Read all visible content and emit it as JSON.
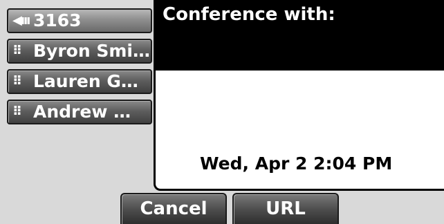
{
  "line_keys": [
    {
      "glyph": "◀ııı",
      "label": "3163",
      "active": true
    },
    {
      "glyph": "⠿",
      "label": "Byron Smi…"
    },
    {
      "glyph": "⠿",
      "label": "Lauren G…"
    },
    {
      "glyph": "⠿",
      "label": "Andrew …"
    }
  ],
  "call": {
    "title": "Conference with:",
    "datetime": "Wed, Apr 2  2:04 PM"
  },
  "softkeys": {
    "cancel": "Cancel",
    "url": "URL"
  }
}
